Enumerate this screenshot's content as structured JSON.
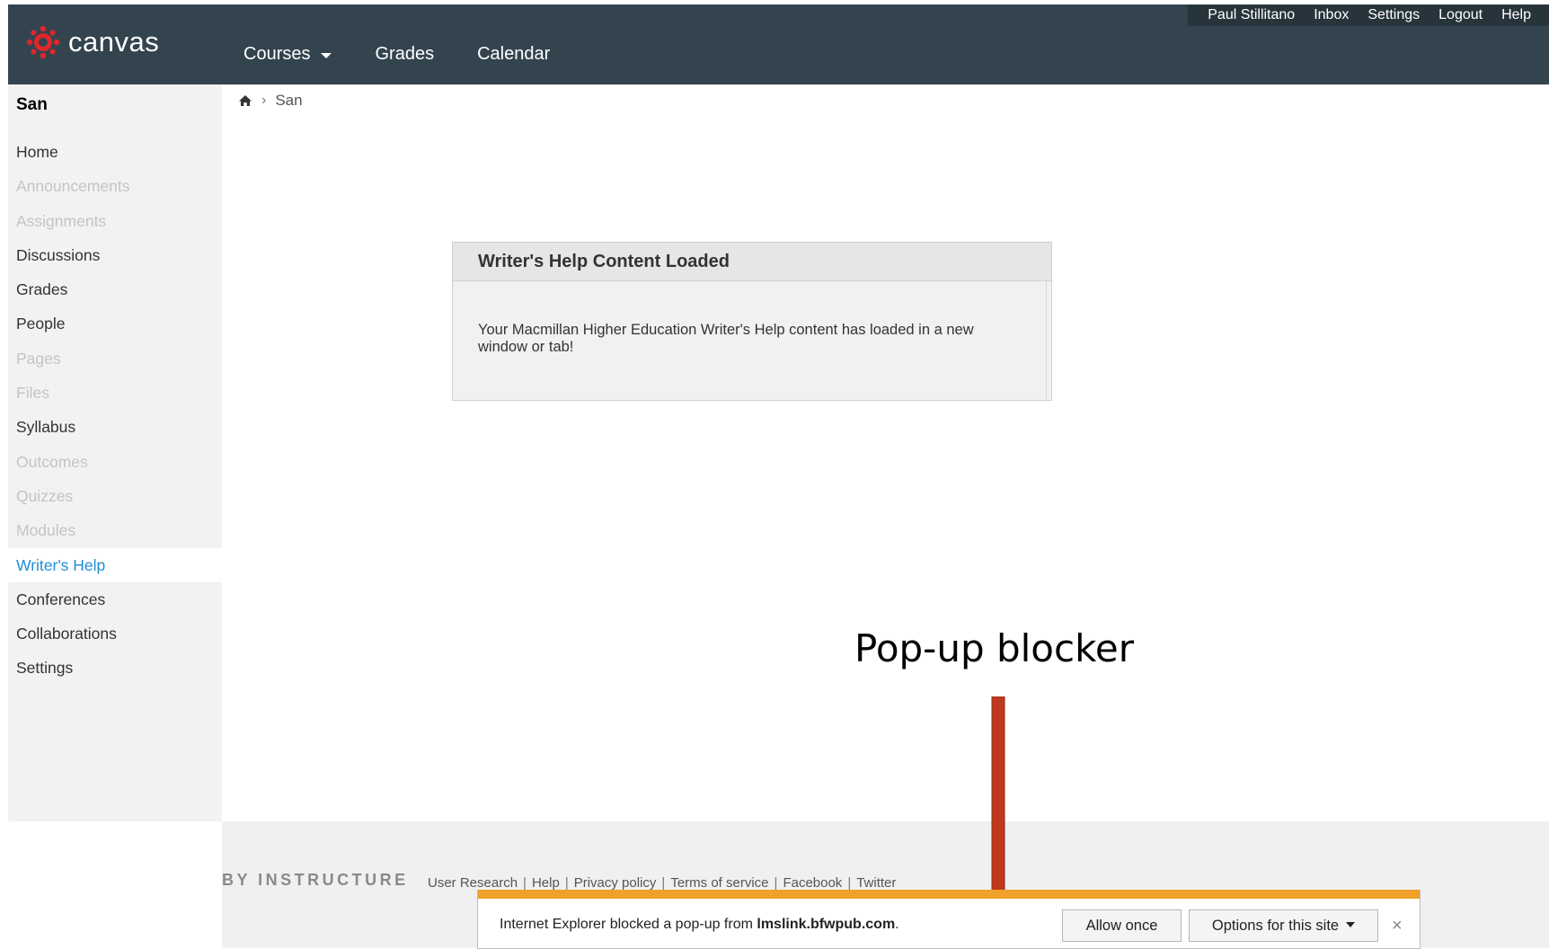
{
  "header": {
    "logo_text": "canvas",
    "nav": [
      {
        "label": "Courses",
        "has_dropdown": true
      },
      {
        "label": "Grades"
      },
      {
        "label": "Calendar"
      }
    ],
    "user_links": [
      "Paul Stillitano",
      "Inbox",
      "Settings",
      "Logout",
      "Help"
    ],
    "colors": {
      "bar": "#33444f",
      "logo": "#e0262c"
    }
  },
  "sidebar": {
    "course_title": "San",
    "items": [
      {
        "label": "Home",
        "state": "normal"
      },
      {
        "label": "Announcements",
        "state": "disabled"
      },
      {
        "label": "Assignments",
        "state": "disabled"
      },
      {
        "label": "Discussions",
        "state": "normal"
      },
      {
        "label": "Grades",
        "state": "normal"
      },
      {
        "label": "People",
        "state": "normal"
      },
      {
        "label": "Pages",
        "state": "disabled"
      },
      {
        "label": "Files",
        "state": "disabled"
      },
      {
        "label": "Syllabus",
        "state": "normal"
      },
      {
        "label": "Outcomes",
        "state": "disabled"
      },
      {
        "label": "Quizzes",
        "state": "disabled"
      },
      {
        "label": "Modules",
        "state": "disabled"
      },
      {
        "label": "Writer's Help",
        "state": "active"
      },
      {
        "label": "Conferences",
        "state": "normal"
      },
      {
        "label": "Collaborations",
        "state": "normal"
      },
      {
        "label": "Settings",
        "state": "normal"
      }
    ]
  },
  "breadcrumb": {
    "home_icon": "home-icon",
    "current": "San"
  },
  "message": {
    "title": "Writer's Help Content Loaded",
    "body": "Your Macmillan Higher Education Writer's Help content has loaded in a new window or tab!"
  },
  "footer": {
    "brand": "BY INSTRUCTURE",
    "links": [
      "User Research",
      "Help",
      "Privacy policy",
      "Terms of service",
      "Facebook",
      "Twitter"
    ]
  },
  "annotation": {
    "label": "Pop-up blocker",
    "arrow_color": "#c0391c"
  },
  "ie_popup_bar": {
    "message_prefix": "Internet Explorer blocked a pop-up from ",
    "domain": "lmslink.bfwpub.com",
    "message_suffix": ".",
    "allow_button": "Allow once",
    "options_button": "Options for this site",
    "close_glyph": "×",
    "stripe_color": "#efa12a"
  }
}
